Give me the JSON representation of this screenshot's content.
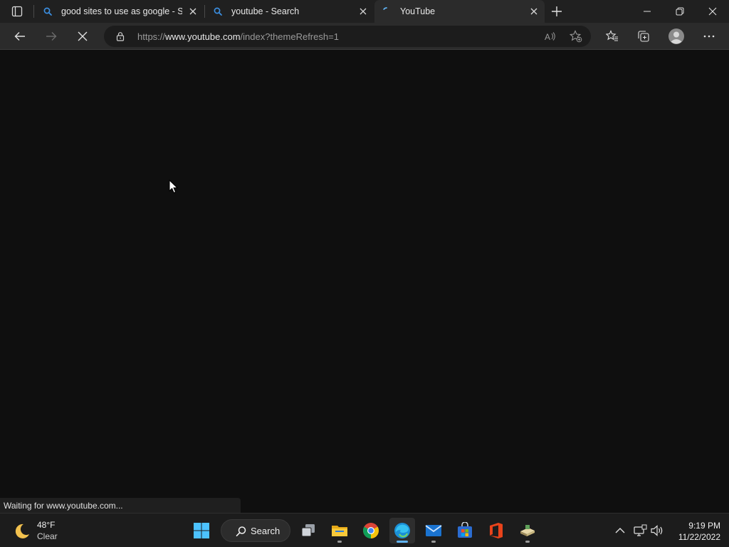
{
  "browser": {
    "tabs": [
      {
        "title": "good sites to use as google - Se",
        "favicon": "search-icon",
        "active": false
      },
      {
        "title": "youtube - Search",
        "favicon": "search-icon",
        "active": false
      },
      {
        "title": "YouTube",
        "favicon": "loading-icon",
        "active": true
      }
    ],
    "address": {
      "protocol": "https://",
      "host": "www.youtube.com",
      "path": "/index?themeRefresh=1"
    },
    "status_text": "Waiting for www.youtube.com...",
    "colors": {
      "accent": "#5fb2f2",
      "page_background": "#0f0f0f"
    }
  },
  "taskbar": {
    "weather": {
      "temperature": "48°F",
      "condition": "Clear",
      "icon": "moon-icon"
    },
    "search_label": "Search",
    "apps": [
      {
        "name": "start",
        "icon": "windows-logo-icon"
      },
      {
        "name": "task-view",
        "icon": "task-view-icon"
      },
      {
        "name": "file-explorer",
        "icon": "folder-icon"
      },
      {
        "name": "chrome",
        "icon": "chrome-icon"
      },
      {
        "name": "edge",
        "icon": "edge-icon"
      },
      {
        "name": "mail",
        "icon": "mail-icon"
      },
      {
        "name": "store",
        "icon": "store-icon"
      },
      {
        "name": "office",
        "icon": "office-icon"
      },
      {
        "name": "misc-app",
        "icon": "app-icon"
      }
    ],
    "clock": {
      "time": "9:19 PM",
      "date": "11/22/2022"
    }
  }
}
